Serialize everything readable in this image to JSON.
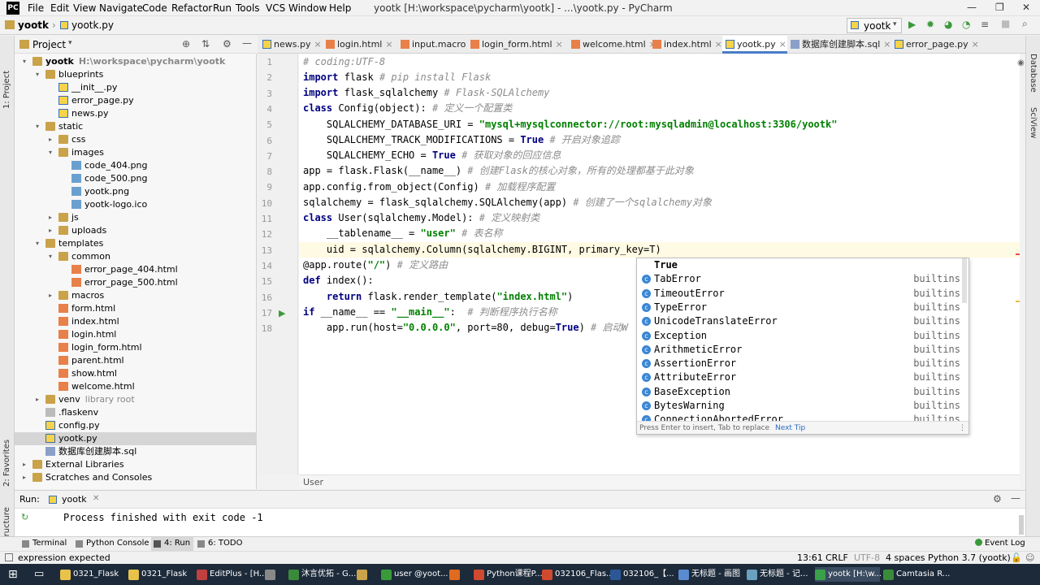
{
  "menubar": {
    "items": [
      "File",
      "Edit",
      "View",
      "Navigate",
      "Code",
      "Refactor",
      "Run",
      "Tools",
      "VCS",
      "Window",
      "Help"
    ],
    "title": "yootk [H:\\workspace\\pycharm\\yootk] - ...\\yootk.py - PyCharm",
    "minimize": "—",
    "maximize": "❐",
    "close": "✕"
  },
  "navbar": {
    "project": "yootk",
    "file": "yootk.py",
    "run_config": "yootk"
  },
  "leftstrip": {
    "project": "1: Project",
    "favorites": "2: Favorites",
    "structure": "Z: Structure"
  },
  "rightstrip": {
    "database": "Database",
    "sciview": "SciView"
  },
  "project_panel": {
    "title": "Project",
    "tree": [
      {
        "name": "yootk",
        "extra": "H:\\workspace\\pycharm\\yootk",
        "depth": 0,
        "type": "folder",
        "arrow": "▾",
        "bold": true
      },
      {
        "name": "blueprints",
        "depth": 1,
        "type": "folder",
        "arrow": "▾"
      },
      {
        "name": "__init__.py",
        "depth": 2,
        "type": "py"
      },
      {
        "name": "error_page.py",
        "depth": 2,
        "type": "py"
      },
      {
        "name": "news.py",
        "depth": 2,
        "type": "py"
      },
      {
        "name": "static",
        "depth": 1,
        "type": "folder",
        "arrow": "▾"
      },
      {
        "name": "css",
        "depth": 2,
        "type": "folder",
        "arrow": "▸"
      },
      {
        "name": "images",
        "depth": 2,
        "type": "folder",
        "arrow": "▾"
      },
      {
        "name": "code_404.png",
        "depth": 3,
        "type": "img"
      },
      {
        "name": "code_500.png",
        "depth": 3,
        "type": "img"
      },
      {
        "name": "yootk.png",
        "depth": 3,
        "type": "img"
      },
      {
        "name": "yootk-logo.ico",
        "depth": 3,
        "type": "img"
      },
      {
        "name": "js",
        "depth": 2,
        "type": "folder",
        "arrow": "▸"
      },
      {
        "name": "uploads",
        "depth": 2,
        "type": "folder",
        "arrow": "▸"
      },
      {
        "name": "templates",
        "depth": 1,
        "type": "folder",
        "arrow": "▾"
      },
      {
        "name": "common",
        "depth": 2,
        "type": "folder",
        "arrow": "▾"
      },
      {
        "name": "error_page_404.html",
        "depth": 3,
        "type": "html"
      },
      {
        "name": "error_page_500.html",
        "depth": 3,
        "type": "html"
      },
      {
        "name": "macros",
        "depth": 2,
        "type": "folder",
        "arrow": "▸"
      },
      {
        "name": "form.html",
        "depth": 2,
        "type": "html"
      },
      {
        "name": "index.html",
        "depth": 2,
        "type": "html"
      },
      {
        "name": "login.html",
        "depth": 2,
        "type": "html"
      },
      {
        "name": "login_form.html",
        "depth": 2,
        "type": "html"
      },
      {
        "name": "parent.html",
        "depth": 2,
        "type": "html"
      },
      {
        "name": "show.html",
        "depth": 2,
        "type": "html"
      },
      {
        "name": "welcome.html",
        "depth": 2,
        "type": "html"
      },
      {
        "name": "venv",
        "extra": "library root",
        "depth": 1,
        "type": "folder",
        "arrow": "▸"
      },
      {
        "name": ".flaskenv",
        "depth": 1,
        "type": "txt"
      },
      {
        "name": "config.py",
        "depth": 1,
        "type": "py"
      },
      {
        "name": "yootk.py",
        "depth": 1,
        "type": "py",
        "selected": true
      },
      {
        "name": "数据库创建脚本.sql",
        "depth": 1,
        "type": "sql"
      },
      {
        "name": "External Libraries",
        "depth": 0,
        "type": "folder",
        "arrow": "▸"
      },
      {
        "name": "Scratches and Consoles",
        "depth": 0,
        "type": "folder",
        "arrow": "▸"
      }
    ]
  },
  "tabs": [
    {
      "label": "news.py",
      "type": "py"
    },
    {
      "label": "login.html",
      "type": "html"
    },
    {
      "label": "input.macro",
      "type": "html"
    },
    {
      "label": "login_form.html",
      "type": "html"
    },
    {
      "label": "welcome.html",
      "type": "html"
    },
    {
      "label": "index.html",
      "type": "html"
    },
    {
      "label": "yootk.py",
      "type": "py",
      "active": true
    },
    {
      "label": "数据库创建脚本.sql",
      "type": "sql"
    },
    {
      "label": "error_page.py",
      "type": "py"
    }
  ],
  "code_lines": [
    "1",
    "2",
    "3",
    "4",
    "5",
    "6",
    "7",
    "8",
    "9",
    "10",
    "11",
    "12",
    "13",
    "14",
    "15",
    "16",
    "17",
    "18"
  ],
  "breadcrumb": "User",
  "autocomplete": {
    "items": [
      {
        "name": "True",
        "type": "",
        "keyword": true
      },
      {
        "name": "TabError",
        "type": "builtins"
      },
      {
        "name": "TimeoutError",
        "type": "builtins"
      },
      {
        "name": "TypeError",
        "type": "builtins"
      },
      {
        "name": "UnicodeTranslateError",
        "type": "builtins"
      },
      {
        "name": "Exception",
        "type": "builtins"
      },
      {
        "name": "ArithmeticError",
        "type": "builtins"
      },
      {
        "name": "AssertionError",
        "type": "builtins"
      },
      {
        "name": "AttributeError",
        "type": "builtins"
      },
      {
        "name": "BaseException",
        "type": "builtins"
      },
      {
        "name": "BytesWarning",
        "type": "builtins"
      },
      {
        "name": "ConnectionAbortedError",
        "type": "builtins"
      }
    ],
    "footer": "Press Enter to insert, Tab to replace",
    "next_tip": "Next Tip",
    "icon_letter": "c"
  },
  "run_panel": {
    "label": "Run:",
    "config": "yootk",
    "output": "Process finished with exit code -1"
  },
  "bottom_tools": [
    {
      "label": "Terminal"
    },
    {
      "label": "Python Console"
    },
    {
      "label": "4: Run",
      "active": true
    },
    {
      "label": "6: TODO"
    }
  ],
  "event_log": "Event Log",
  "status": {
    "message": "expression expected",
    "position": "13:61",
    "line_sep": "CRLF",
    "encoding": "UTF-8",
    "indent": "4 spaces",
    "interpreter": "Python 3.7 (yootk)"
  },
  "taskbar": [
    {
      "label": "0321_Flask",
      "color": "#e8c24a"
    },
    {
      "label": "0321_Flask",
      "color": "#e8c24a"
    },
    {
      "label": "EditPlus - [H...",
      "color": "#c04040"
    },
    {
      "label": "",
      "color": "#888"
    },
    {
      "label": "沐言优拓 - G...",
      "color": "#3b8a3b"
    },
    {
      "label": "",
      "color": "#c9a24a"
    },
    {
      "label": "user @yoot...",
      "color": "#3a9a3a"
    },
    {
      "label": "",
      "color": "#e06a20"
    },
    {
      "label": "Python课程P...",
      "color": "#d04a30"
    },
    {
      "label": "032106_Flas...",
      "color": "#d04a30"
    },
    {
      "label": "032106_【...",
      "color": "#2b5797"
    },
    {
      "label": "无标题 - 画图",
      "color": "#5a8ad0"
    },
    {
      "label": "无标题 - 记...",
      "color": "#6aa0c0"
    },
    {
      "label": "yootk [H:\\w...",
      "color": "#3aa04a",
      "active": true
    },
    {
      "label": "Camtasia R...",
      "color": "#3a8a3a"
    }
  ]
}
